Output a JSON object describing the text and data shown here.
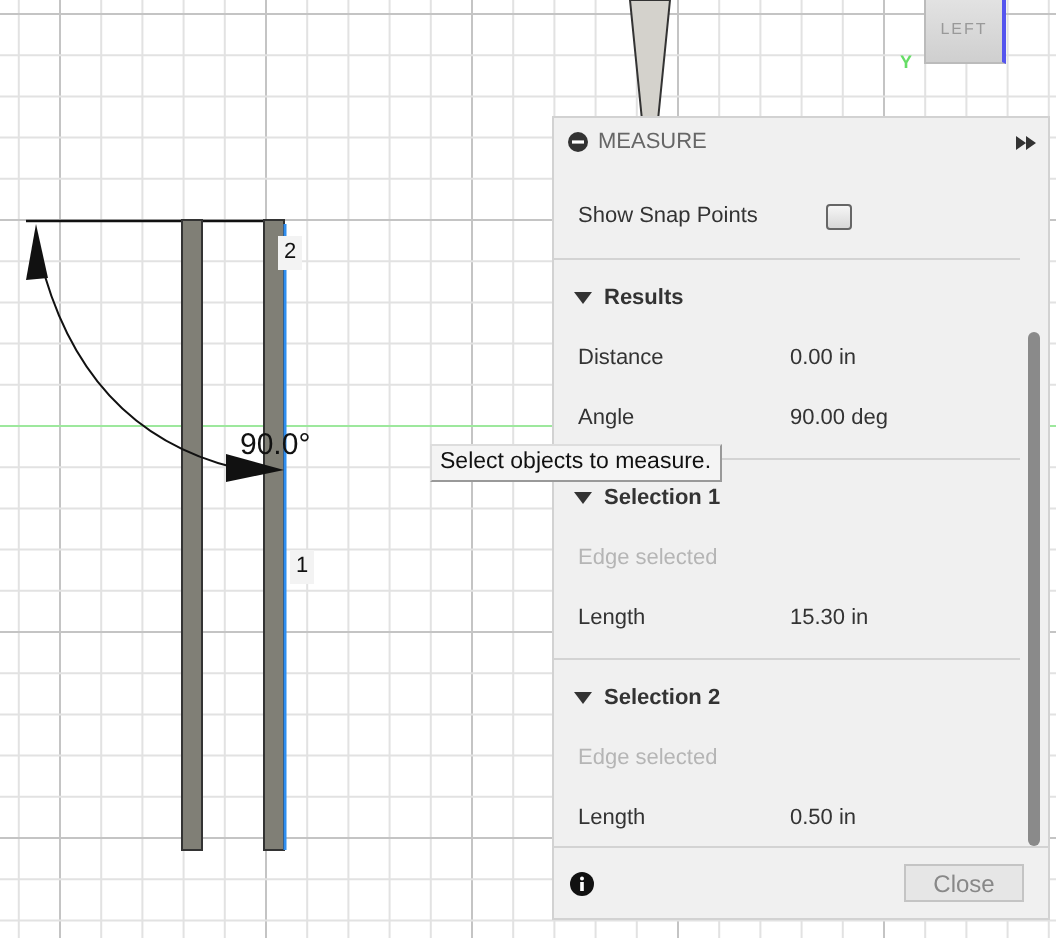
{
  "viewport": {
    "angle_label": "90.0°",
    "edge_labels": [
      "2",
      "1"
    ],
    "view_cube": {
      "face": "LEFT",
      "axis": "Y"
    }
  },
  "tooltip": "Select objects to measure.",
  "panel": {
    "title": "MEASURE",
    "snap": {
      "label": "Show Snap Points",
      "checked": false
    },
    "sections": [
      {
        "title": "Results",
        "expanded": true,
        "rows": [
          {
            "kind": "value",
            "label": "Distance",
            "value": "0.00 in"
          },
          {
            "kind": "value",
            "label": "Angle",
            "value": "90.00 deg"
          }
        ]
      },
      {
        "title": "Selection 1",
        "expanded": true,
        "rows": [
          {
            "kind": "note",
            "label": "Edge selected"
          },
          {
            "kind": "value",
            "label": "Length",
            "value": "15.30 in"
          }
        ]
      },
      {
        "title": "Selection 2",
        "expanded": true,
        "rows": [
          {
            "kind": "note",
            "label": "Edge selected"
          },
          {
            "kind": "value",
            "label": "Length",
            "value": "0.50 in"
          }
        ]
      }
    ],
    "close": "Close"
  }
}
